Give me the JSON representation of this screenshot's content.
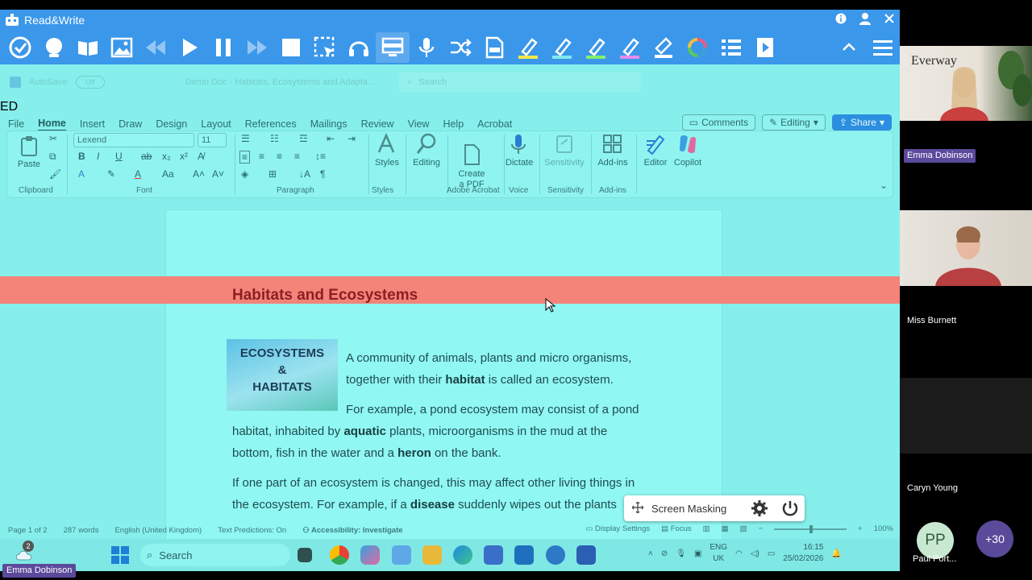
{
  "readwrite": {
    "title": "Read&Write",
    "tools": [
      "check-icon",
      "prediction-icon",
      "dictionary-icon",
      "picture-dictionary-icon",
      "rewind-icon",
      "play-icon",
      "pause-icon",
      "forward-icon",
      "stop-icon",
      "screenshot-reader-icon",
      "audio-maker-icon",
      "screen-mask-icon",
      "talk-and-type-icon",
      "translator-icon",
      "pdf-reader-icon",
      "highlight-yellow-icon",
      "highlight-green-icon",
      "highlight-lightgreen-icon",
      "highlight-pink-icon",
      "clear-highlights-icon",
      "collect-highlights-icon",
      "vocabulary-list-icon",
      "practice-reading-icon"
    ]
  },
  "word": {
    "autosave": "AutoSave",
    "autosave_state": "Off",
    "doc_title": "Demo Doc - Habitats, Ecosystems and Adapta...",
    "search_placeholder": "Search",
    "user_initials": "ED",
    "tabs": [
      "File",
      "Home",
      "Insert",
      "Draw",
      "Design",
      "Layout",
      "References",
      "Mailings",
      "Review",
      "View",
      "Help",
      "Acrobat"
    ],
    "comments": "Comments",
    "editing": "Editing",
    "share": "Share"
  },
  "ribbon": {
    "paste": "Paste",
    "font_name": "Lexend",
    "font_size": "11",
    "styles": "Styles",
    "editing": "Editing",
    "create_pdf": "Create\na PDF",
    "dictate": "Dictate",
    "sensitivity": "Sensitivity",
    "addins": "Add-ins",
    "editor": "Editor",
    "copilot": "Copilot",
    "groups": {
      "clipboard": "Clipboard",
      "font": "Font",
      "paragraph": "Paragraph",
      "styles": "Styles",
      "adobe": "Adobe Acrobat",
      "voice": "Voice",
      "sensitivity": "Sensitivity",
      "addins": "Add-ins"
    }
  },
  "document": {
    "heading": "Habitats and Ecosystems",
    "image_lines": [
      "ECOSYSTEMS",
      "&",
      "HABITATS"
    ],
    "p1_a": "A community of animals, plants and micro organisms,",
    "p1_b": "together with their ",
    "p1_bold": "habitat",
    "p1_c": " is called an ecosystem.",
    "p2_a": "For example, a pond ecosystem may consist of a pond",
    "p2_b": "habitat, inhabited by ",
    "p2_bold1": "aquatic",
    "p2_c": " plants, microorganisms in the mud at the",
    "p2_d": "bottom, fish in the water and a ",
    "p2_bold2": "heron",
    "p2_e": " on the bank.",
    "p3_a": "If one part of an ecosystem is changed, this may affect other living things in",
    "p3_b": "the ecosystem. For example, if a ",
    "p3_bold": "disease",
    "p3_c": " suddenly wipes out the plants"
  },
  "status": {
    "page": "Page 1 of 2",
    "words": "287 words",
    "language": "English (United Kingdom)",
    "predictions": "Text Predictions: On",
    "accessibility": "Accessibility: Investigate",
    "display_settings": "Display Settings",
    "focus": "Focus",
    "zoom": "100%"
  },
  "taskbar": {
    "search": "Search",
    "lang_top": "ENG",
    "lang_bottom": "UK",
    "time": "16:15",
    "date": "25/02/2026",
    "notif_count": "2"
  },
  "screen_mask": {
    "label": "Screen Masking"
  },
  "presenter": "Emma Dobinson",
  "participants": {
    "logo_text": "Everway",
    "p1": "Emma Dobinson",
    "p2": "Miss Burnett",
    "p3": "Caryn Young",
    "p4_initials": "PP",
    "p4_name": "Paul Port...",
    "more": "+30"
  },
  "colors": {
    "rw_blue": "#3a97ea",
    "mask_tint": "#86efeb",
    "mask_band": "#f48379",
    "heading": "#8b1f22",
    "share_blue": "#2b8ee0",
    "tag_purple": "#5b4a9c"
  }
}
